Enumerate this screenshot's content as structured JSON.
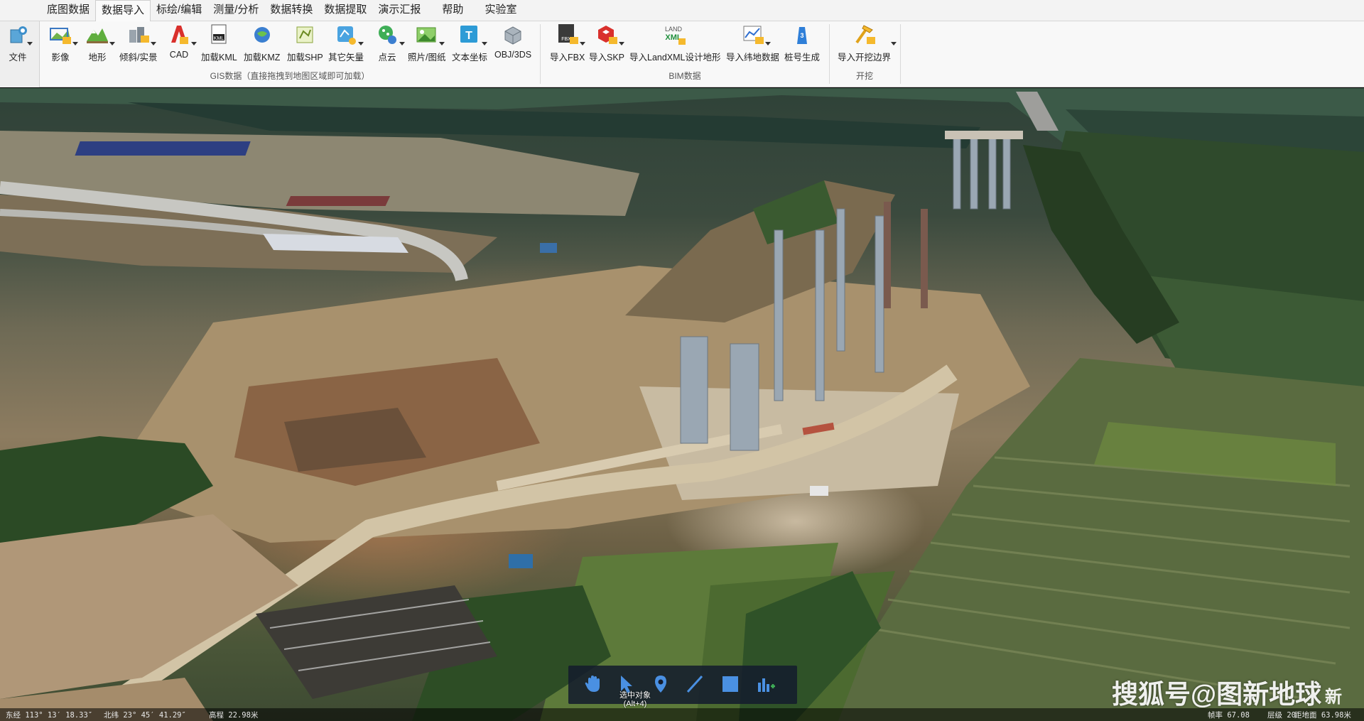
{
  "menu": {
    "tabs": [
      {
        "label": "底图数据"
      },
      {
        "label": "数据导入"
      },
      {
        "label": "标绘/编辑"
      },
      {
        "label": "测量/分析"
      },
      {
        "label": "数据转换"
      },
      {
        "label": "数据提取"
      },
      {
        "label": "演示汇报"
      },
      {
        "label": "帮助"
      },
      {
        "label": "实验室"
      }
    ],
    "active_tab": "数据导入"
  },
  "ribbon": {
    "file_label": "文件",
    "gis_group_label": "GIS数据（直接拖拽到地图区域即可加载）",
    "bim_group_label": "BIM数据",
    "excavation_group_label": "开挖",
    "gis_buttons": [
      {
        "label": "影像",
        "icon": "imagery-icon"
      },
      {
        "label": "地形",
        "icon": "terrain-icon"
      },
      {
        "label": "倾斜/实景",
        "icon": "oblique-icon"
      },
      {
        "label": "CAD",
        "icon": "cad-icon"
      },
      {
        "label": "加载KML",
        "icon": "kml-icon"
      },
      {
        "label": "加载KMZ",
        "icon": "kmz-icon"
      },
      {
        "label": "加载SHP",
        "icon": "shp-icon"
      },
      {
        "label": "其它矢量",
        "icon": "vector-icon"
      },
      {
        "label": "点云",
        "icon": "pointcloud-icon"
      },
      {
        "label": "照片/图纸",
        "icon": "photo-icon"
      },
      {
        "label": "文本坐标",
        "icon": "text-coord-icon"
      },
      {
        "label": "OBJ/3DS",
        "icon": "obj-icon"
      }
    ],
    "bim_buttons": [
      {
        "label": "导入FBX",
        "icon": "fbx-icon",
        "badge": "FBX"
      },
      {
        "label": "导入SKP",
        "icon": "skp-icon"
      },
      {
        "label": "导入LandXML设计地形",
        "icon": "landxml-icon",
        "badge": "LAND XML"
      },
      {
        "label": "导入纬地数据",
        "icon": "weidi-icon"
      },
      {
        "label": "桩号生成",
        "icon": "station-icon"
      }
    ],
    "excavation_buttons": [
      {
        "label": "导入开挖边界",
        "icon": "excavation-icon"
      }
    ]
  },
  "float_toolbar": {
    "tools": [
      "pan-hand-icon",
      "select-arrow-icon",
      "place-marker-icon",
      "draw-line-icon",
      "draw-rect-icon",
      "chart-add-icon"
    ],
    "tooltip_line1": "选中对象",
    "tooltip_line2": "(Alt+4)"
  },
  "status": {
    "longitude": "东经 113° 13′ 18.33″",
    "latitude": "北纬 23° 45′ 41.29″",
    "altitude": "高程 22.98米",
    "frame_rate": "帧率 67.08",
    "level": "层级 20",
    "distance": "距地面 63.98米"
  },
  "watermark": {
    "text": "搜狐号@图新地球",
    "tail": "新"
  },
  "colors": {
    "ribbon_bg": "#f8f8f8",
    "menu_bg": "#f3f3f3",
    "toolbar_bg": "#141c2c",
    "tool_accent": "#4a90e2"
  }
}
